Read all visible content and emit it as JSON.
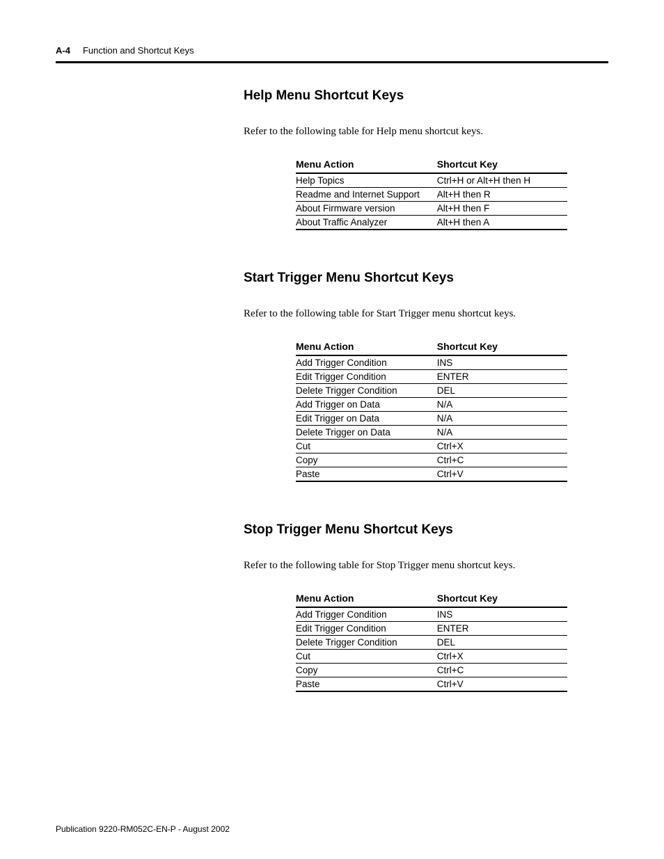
{
  "header": {
    "page_num": "A-4",
    "title": "Function and Shortcut Keys"
  },
  "sections": [
    {
      "title": "Help Menu Shortcut Keys",
      "intro": "Refer to the following table for Help menu shortcut keys.",
      "col1": "Menu Action",
      "col2": "Shortcut Key",
      "rows": [
        {
          "a": "Help Topics",
          "k": "Ctrl+H or Alt+H then H"
        },
        {
          "a": "Readme and Internet Support",
          "k": "Alt+H then R"
        },
        {
          "a": "About Firmware version",
          "k": "Alt+H then F"
        },
        {
          "a": "About Traffic Analyzer",
          "k": "Alt+H then A"
        }
      ]
    },
    {
      "title": "Start Trigger Menu Shortcut Keys",
      "intro": "Refer to the following table for Start Trigger menu shortcut keys.",
      "col1": "Menu Action",
      "col2": "Shortcut Key",
      "rows": [
        {
          "a": "Add Trigger Condition",
          "k": "INS"
        },
        {
          "a": "Edit Trigger Condition",
          "k": "ENTER"
        },
        {
          "a": "Delete Trigger Condition",
          "k": "DEL"
        },
        {
          "a": "Add Trigger on Data",
          "k": "N/A"
        },
        {
          "a": "Edit Trigger on Data",
          "k": "N/A"
        },
        {
          "a": "Delete Trigger on Data",
          "k": "N/A"
        },
        {
          "a": "Cut",
          "k": "Ctrl+X"
        },
        {
          "a": "Copy",
          "k": "Ctrl+C"
        },
        {
          "a": "Paste",
          "k": "Ctrl+V"
        }
      ]
    },
    {
      "title": "Stop Trigger Menu Shortcut Keys",
      "intro": "Refer to the following table for Stop Trigger menu shortcut keys.",
      "col1": "Menu Action",
      "col2": "Shortcut Key",
      "rows": [
        {
          "a": "Add Trigger Condition",
          "k": "INS"
        },
        {
          "a": "Edit Trigger Condition",
          "k": "ENTER"
        },
        {
          "a": "Delete Trigger Condition",
          "k": "DEL"
        },
        {
          "a": "Cut",
          "k": "Ctrl+X"
        },
        {
          "a": "Copy",
          "k": "Ctrl+C"
        },
        {
          "a": "Paste",
          "k": "Ctrl+V"
        }
      ]
    }
  ],
  "footer": "Publication 9220-RM052C-EN-P - August 2002"
}
